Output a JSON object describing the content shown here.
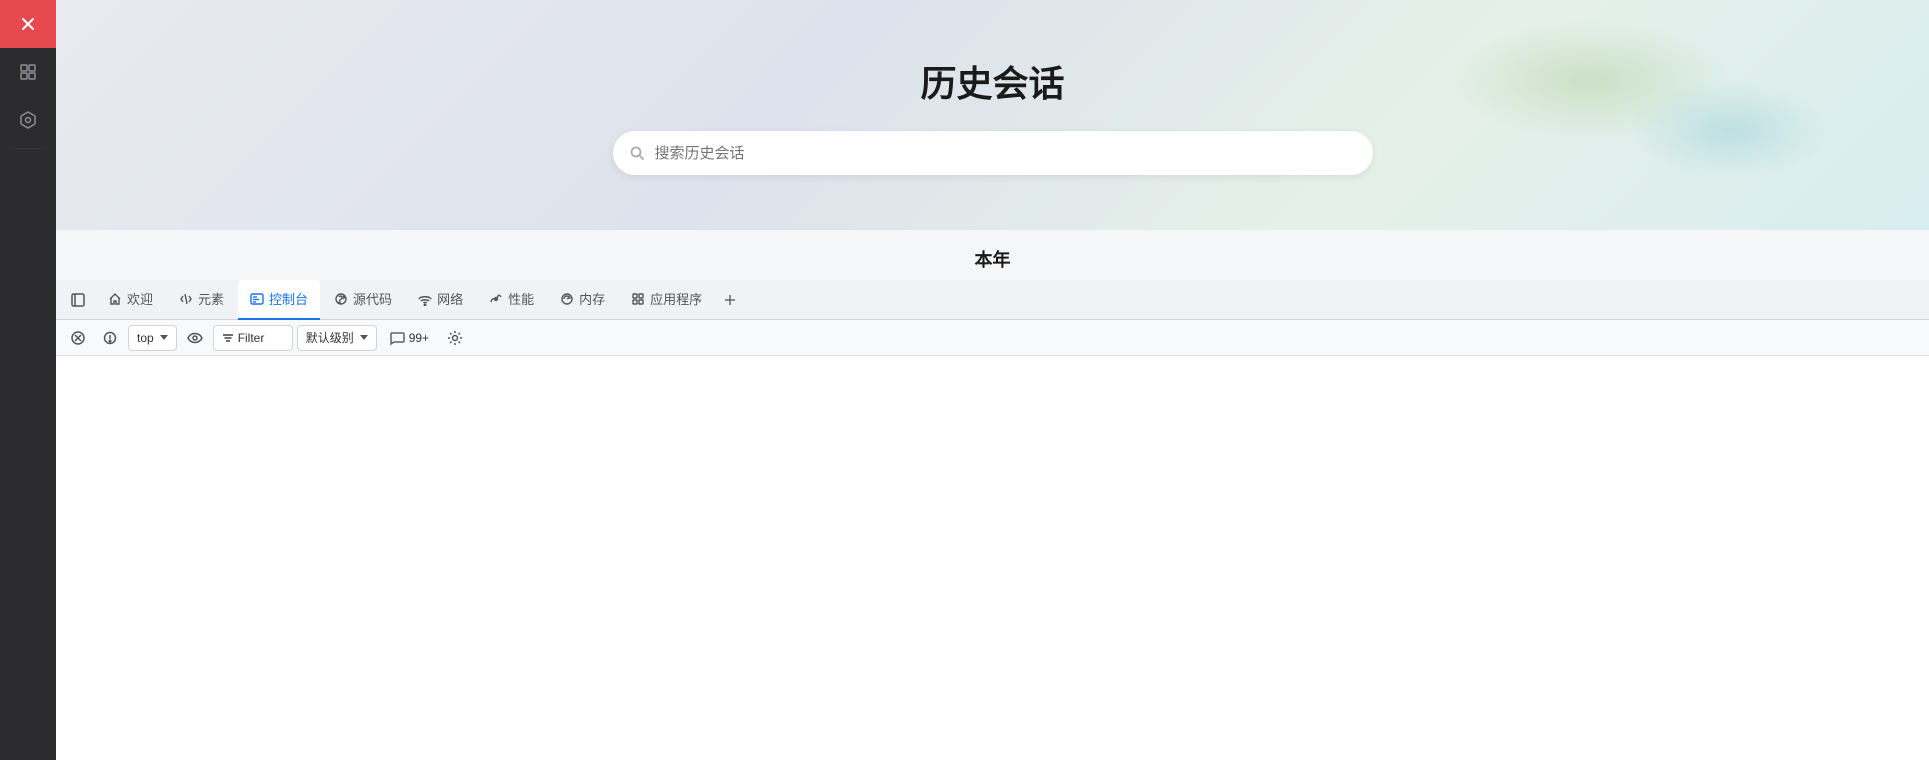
{
  "sidebar": {
    "close_label": "×",
    "icons": [
      {
        "name": "layers-icon",
        "symbol": "⊙"
      },
      {
        "name": "hexagon-icon",
        "symbol": "⬡"
      }
    ]
  },
  "history": {
    "title": "历史会话",
    "search_placeholder": "搜索历史会话",
    "year_label": "本年"
  },
  "devtools": {
    "tabs": [
      {
        "id": "welcome",
        "label": "欢迎",
        "icon": "home"
      },
      {
        "id": "elements",
        "label": "元素",
        "icon": "code"
      },
      {
        "id": "console",
        "label": "控制台",
        "icon": "console",
        "active": true
      },
      {
        "id": "sources",
        "label": "源代码",
        "icon": "bug"
      },
      {
        "id": "network",
        "label": "网络",
        "icon": "wifi"
      },
      {
        "id": "performance",
        "label": "性能",
        "icon": "performance"
      },
      {
        "id": "memory",
        "label": "内存",
        "icon": "gear"
      },
      {
        "id": "application",
        "label": "应用程序",
        "icon": "app"
      }
    ],
    "toolbar": {
      "context_selector": "top",
      "filter_placeholder": "Filter",
      "level_label": "默认级别",
      "messages_count": "99+",
      "settings_icon": "gear"
    }
  }
}
